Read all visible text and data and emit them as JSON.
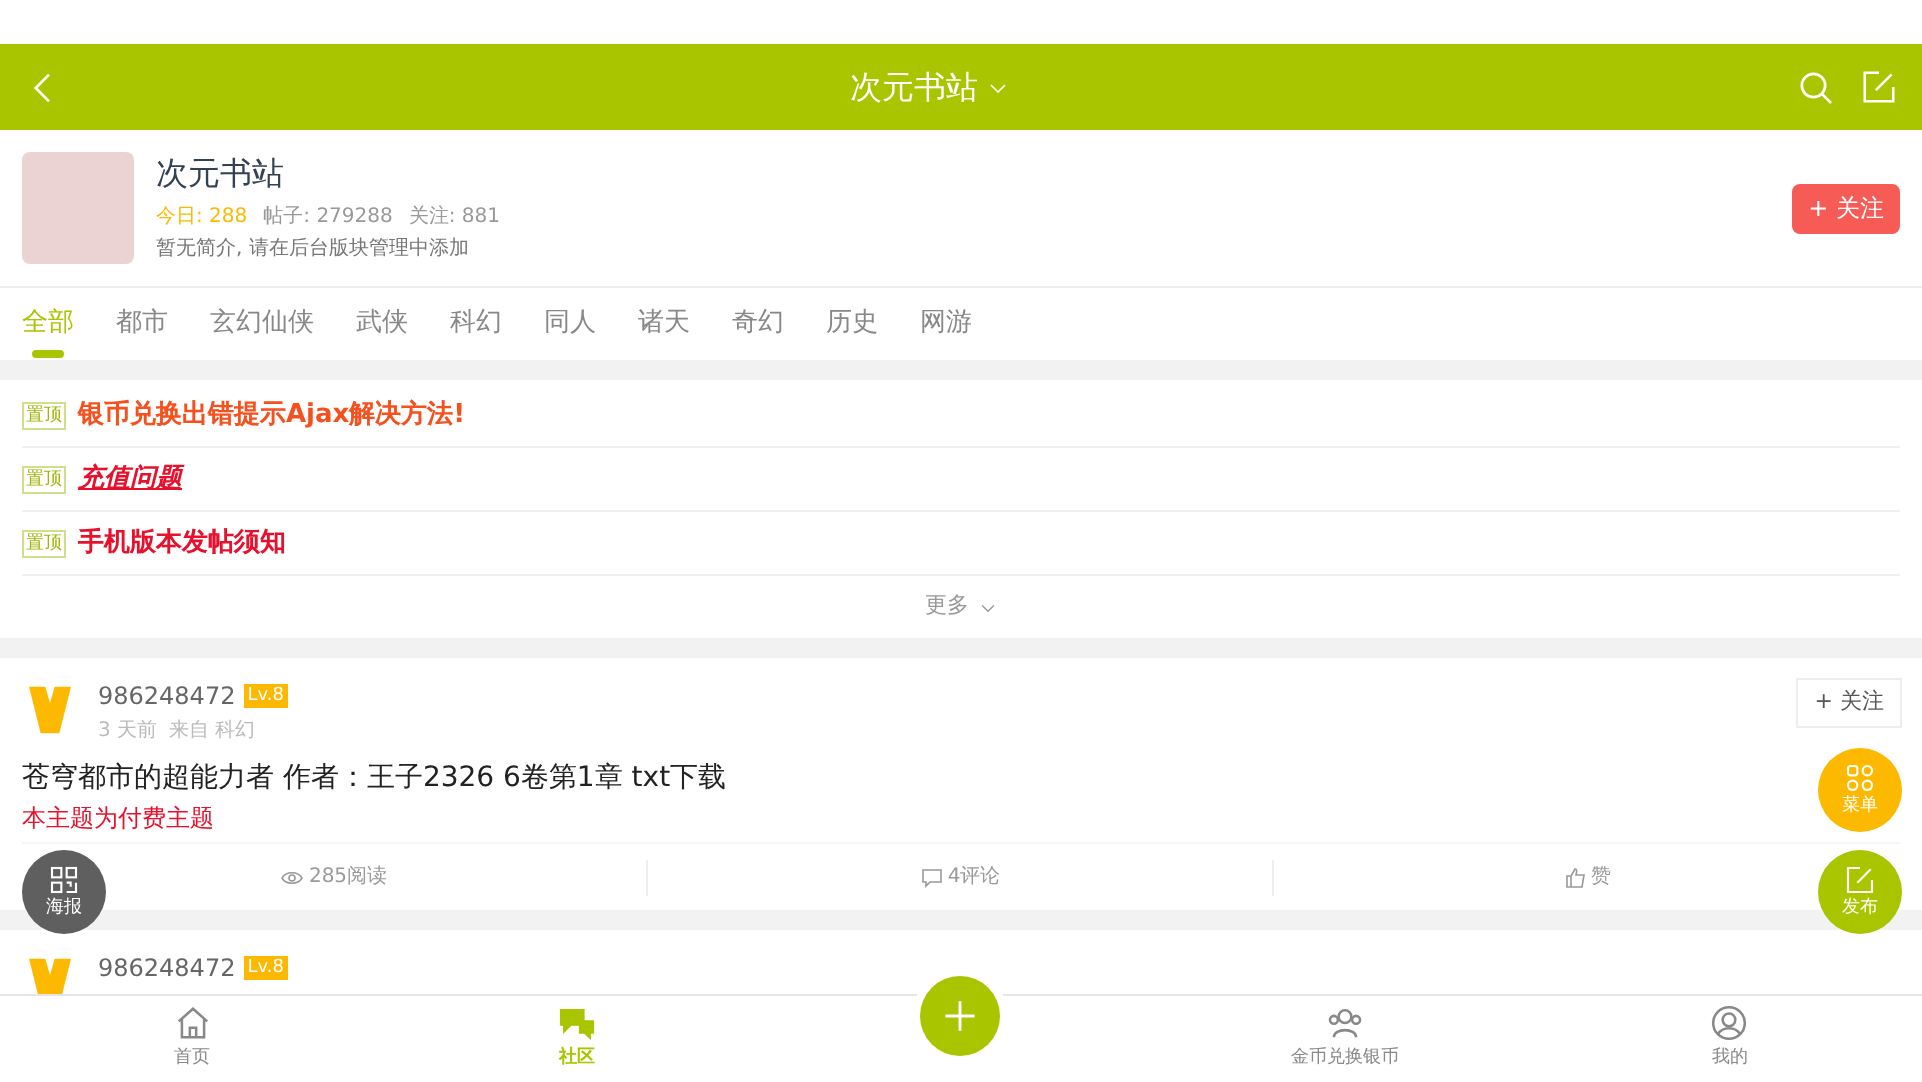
{
  "header": {
    "title": "次元书站"
  },
  "forum": {
    "name": "次元书站",
    "today_label": "今日: 288",
    "posts": "帖子: 279288",
    "followers": "关注: 881",
    "intro": "暂无简介, 请在后台版块管理中添加",
    "follow_button": "+ 关注"
  },
  "tabs": [
    {
      "label": "全部",
      "selected": true
    },
    {
      "label": "都市",
      "selected": false
    },
    {
      "label": "玄幻仙侠",
      "selected": false
    },
    {
      "label": "武侠",
      "selected": false
    },
    {
      "label": "科幻",
      "selected": false
    },
    {
      "label": "同人",
      "selected": false
    },
    {
      "label": "诸天",
      "selected": false
    },
    {
      "label": "奇幻",
      "selected": false
    },
    {
      "label": "历史",
      "selected": false
    },
    {
      "label": "网游",
      "selected": false
    }
  ],
  "pinned": [
    {
      "tag": "置顶",
      "title": "银币兑换出错提示Ajax解决方法!",
      "color": "#f4511e",
      "italic": false,
      "underline": false
    },
    {
      "tag": "置顶",
      "title": "充值问题",
      "color": "#e8112d",
      "italic": true,
      "underline": true
    },
    {
      "tag": "置顶",
      "title": "手机版本发帖须知",
      "color": "#e8112d",
      "italic": false,
      "underline": false
    }
  ],
  "more": "更多",
  "posts": [
    {
      "user": "986248472",
      "level": "Lv.8",
      "time": "3 天前",
      "source": "来自 科幻",
      "follow": "+ 关注",
      "title": "苍穹都市的超能力者 作者：王子2326 6卷第1章 txt下载",
      "notice": "本主题为付费主题",
      "reads": "285阅读",
      "comments": "4评论",
      "likes": "赞"
    },
    {
      "user": "986248472",
      "level": "Lv.8"
    }
  ],
  "floating": {
    "poster": "海报",
    "menu": "菜单",
    "publish": "发布"
  },
  "bottom_nav": [
    {
      "label": "首页",
      "selected": false
    },
    {
      "label": "社区",
      "selected": true
    },
    {
      "label": "金币兑换银币",
      "selected": false
    },
    {
      "label": "我的",
      "selected": false
    }
  ]
}
